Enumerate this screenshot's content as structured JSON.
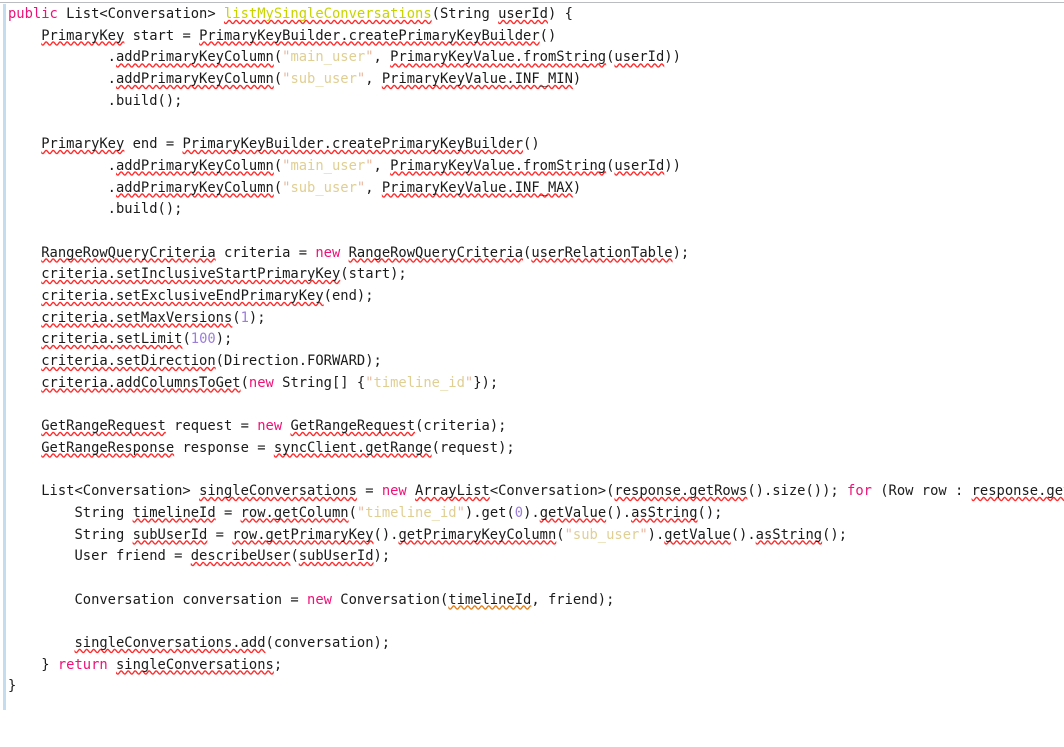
{
  "editor": {
    "language": "java",
    "top_rule_color": "#b9bcc0",
    "left_bar_color": "#c3dcee",
    "background_color": "#ffffff",
    "colors": {
      "keyword": "#ee1177",
      "method_declaration": "#c8d400",
      "string": "#e0cf93",
      "string_quote": "#e8b9a0",
      "number": "#9b7ddb",
      "plain_text": "#1a1a1a",
      "squiggle_error": "#ff2b2b",
      "squiggle_warning": "#e08020"
    }
  },
  "code": {
    "lines": [
      {
        "n": 1,
        "tokens": [
          {
            "t": "public",
            "c": "kw"
          },
          {
            "t": " List<Conversation> ",
            "c": "plain"
          },
          {
            "t": "listMySingleConversations",
            "c": "mname sq"
          },
          {
            "t": "(String ",
            "c": "plain"
          },
          {
            "t": "userId",
            "c": "sq"
          },
          {
            "t": ") {",
            "c": "plain"
          }
        ]
      },
      {
        "n": 2,
        "tokens": [
          {
            "t": "    ",
            "c": "plain"
          },
          {
            "t": "PrimaryKey",
            "c": "sq"
          },
          {
            "t": " start = ",
            "c": "plain"
          },
          {
            "t": "PrimaryKeyBuilder.createPrimaryKeyBuilder",
            "c": "sq"
          },
          {
            "t": "()",
            "c": "plain"
          }
        ]
      },
      {
        "n": 3,
        "tokens": [
          {
            "t": "            .",
            "c": "plain"
          },
          {
            "t": "addPrimaryKeyColumn",
            "c": "sq"
          },
          {
            "t": "(",
            "c": "plain"
          },
          {
            "t": "\"",
            "c": "strq"
          },
          {
            "t": "main_user",
            "c": "str"
          },
          {
            "t": "\"",
            "c": "strq"
          },
          {
            "t": ", ",
            "c": "plain"
          },
          {
            "t": "PrimaryKeyValue.fromString",
            "c": "sq"
          },
          {
            "t": "(",
            "c": "plain"
          },
          {
            "t": "userId",
            "c": "sq"
          },
          {
            "t": "))",
            "c": "plain"
          }
        ]
      },
      {
        "n": 4,
        "tokens": [
          {
            "t": "            .",
            "c": "plain"
          },
          {
            "t": "addPrimaryKeyColumn",
            "c": "sq"
          },
          {
            "t": "(",
            "c": "plain"
          },
          {
            "t": "\"",
            "c": "strq"
          },
          {
            "t": "sub_user",
            "c": "str"
          },
          {
            "t": "\"",
            "c": "strq"
          },
          {
            "t": ", ",
            "c": "plain"
          },
          {
            "t": "PrimaryKeyValue.INF_MIN",
            "c": "sq"
          },
          {
            "t": ")",
            "c": "plain"
          }
        ]
      },
      {
        "n": 5,
        "tokens": [
          {
            "t": "            .build();",
            "c": "plain"
          }
        ]
      },
      {
        "n": 6,
        "tokens": []
      },
      {
        "n": 7,
        "tokens": [
          {
            "t": "    ",
            "c": "plain"
          },
          {
            "t": "PrimaryKey",
            "c": "sq"
          },
          {
            "t": " end = ",
            "c": "plain"
          },
          {
            "t": "PrimaryKeyBuilder.createPrimaryKeyBuilder",
            "c": "sq"
          },
          {
            "t": "()",
            "c": "plain"
          }
        ]
      },
      {
        "n": 8,
        "tokens": [
          {
            "t": "            .",
            "c": "plain"
          },
          {
            "t": "addPrimaryKeyColumn",
            "c": "sq"
          },
          {
            "t": "(",
            "c": "plain"
          },
          {
            "t": "\"",
            "c": "strq"
          },
          {
            "t": "main_user",
            "c": "str"
          },
          {
            "t": "\"",
            "c": "strq"
          },
          {
            "t": ", ",
            "c": "plain"
          },
          {
            "t": "PrimaryKeyValue.fromString",
            "c": "sq"
          },
          {
            "t": "(",
            "c": "plain"
          },
          {
            "t": "userId",
            "c": "sq"
          },
          {
            "t": "))",
            "c": "plain"
          }
        ]
      },
      {
        "n": 9,
        "tokens": [
          {
            "t": "            .",
            "c": "plain"
          },
          {
            "t": "addPrimaryKeyColumn",
            "c": "sq"
          },
          {
            "t": "(",
            "c": "plain"
          },
          {
            "t": "\"",
            "c": "strq"
          },
          {
            "t": "sub_user",
            "c": "str"
          },
          {
            "t": "\"",
            "c": "strq"
          },
          {
            "t": ", ",
            "c": "plain"
          },
          {
            "t": "PrimaryKeyValue.INF_MAX",
            "c": "sq"
          },
          {
            "t": ")",
            "c": "plain"
          }
        ]
      },
      {
        "n": 10,
        "tokens": [
          {
            "t": "            .build();",
            "c": "plain"
          }
        ]
      },
      {
        "n": 11,
        "tokens": []
      },
      {
        "n": 12,
        "tokens": [
          {
            "t": "    ",
            "c": "plain"
          },
          {
            "t": "RangeRowQueryCriteria",
            "c": "sq"
          },
          {
            "t": " criteria = ",
            "c": "plain"
          },
          {
            "t": "new",
            "c": "kw"
          },
          {
            "t": " ",
            "c": "plain"
          },
          {
            "t": "RangeRowQueryCriteria",
            "c": "sq"
          },
          {
            "t": "(",
            "c": "plain"
          },
          {
            "t": "userRelationTable",
            "c": "sq"
          },
          {
            "t": ");",
            "c": "plain"
          }
        ]
      },
      {
        "n": 13,
        "tokens": [
          {
            "t": "    ",
            "c": "plain"
          },
          {
            "t": "criteria.setInclusiveStartPrimaryKey",
            "c": "sq"
          },
          {
            "t": "(start);",
            "c": "plain"
          }
        ]
      },
      {
        "n": 14,
        "tokens": [
          {
            "t": "    ",
            "c": "plain"
          },
          {
            "t": "criteria.setExclusiveEndPrimaryKey",
            "c": "sq"
          },
          {
            "t": "(end);",
            "c": "plain"
          }
        ]
      },
      {
        "n": 15,
        "tokens": [
          {
            "t": "    ",
            "c": "plain"
          },
          {
            "t": "criteria.setMaxVersions",
            "c": "sq"
          },
          {
            "t": "(",
            "c": "plain"
          },
          {
            "t": "1",
            "c": "num"
          },
          {
            "t": ");",
            "c": "plain"
          }
        ]
      },
      {
        "n": 16,
        "tokens": [
          {
            "t": "    ",
            "c": "plain"
          },
          {
            "t": "criteria.setLimit",
            "c": "sq"
          },
          {
            "t": "(",
            "c": "plain"
          },
          {
            "t": "100",
            "c": "num"
          },
          {
            "t": ");",
            "c": "plain"
          }
        ]
      },
      {
        "n": 17,
        "tokens": [
          {
            "t": "    ",
            "c": "plain"
          },
          {
            "t": "criteria.setDirection",
            "c": "sq"
          },
          {
            "t": "(Direction.FORWARD);",
            "c": "plain"
          }
        ]
      },
      {
        "n": 18,
        "tokens": [
          {
            "t": "    ",
            "c": "plain"
          },
          {
            "t": "criteria.addColumnsToGet",
            "c": "sq"
          },
          {
            "t": "(",
            "c": "plain"
          },
          {
            "t": "new",
            "c": "kw"
          },
          {
            "t": " String[] {",
            "c": "plain"
          },
          {
            "t": "\"",
            "c": "strq"
          },
          {
            "t": "timeline_id",
            "c": "str"
          },
          {
            "t": "\"",
            "c": "strq"
          },
          {
            "t": "});",
            "c": "plain"
          }
        ]
      },
      {
        "n": 19,
        "tokens": []
      },
      {
        "n": 20,
        "tokens": [
          {
            "t": "    ",
            "c": "plain"
          },
          {
            "t": "GetRangeRequest",
            "c": "sq"
          },
          {
            "t": " request = ",
            "c": "plain"
          },
          {
            "t": "new",
            "c": "kw"
          },
          {
            "t": " ",
            "c": "plain"
          },
          {
            "t": "GetRangeRequest",
            "c": "sq"
          },
          {
            "t": "(criteria);",
            "c": "plain"
          }
        ]
      },
      {
        "n": 21,
        "tokens": [
          {
            "t": "    ",
            "c": "plain"
          },
          {
            "t": "GetRangeResponse",
            "c": "sq"
          },
          {
            "t": " response = ",
            "c": "plain"
          },
          {
            "t": "syncClient.getRange",
            "c": "sq"
          },
          {
            "t": "(request);",
            "c": "plain"
          }
        ]
      },
      {
        "n": 22,
        "tokens": []
      },
      {
        "n": 23,
        "tokens": [
          {
            "t": "    List<Conversation> ",
            "c": "plain"
          },
          {
            "t": "singleConversations",
            "c": "sq"
          },
          {
            "t": " = ",
            "c": "plain"
          },
          {
            "t": "new",
            "c": "kw"
          },
          {
            "t": " ",
            "c": "plain"
          },
          {
            "t": "ArrayList",
            "c": "sq"
          },
          {
            "t": "<Conversation>(",
            "c": "plain"
          },
          {
            "t": "response.getRows",
            "c": "sq"
          },
          {
            "t": "().size()); ",
            "c": "plain"
          },
          {
            "t": "for",
            "c": "kw"
          },
          {
            "t": " (Row row : ",
            "c": "plain"
          },
          {
            "t": "response.getRows",
            "c": "sq"
          },
          {
            "t": "()) {",
            "c": "plain"
          }
        ]
      },
      {
        "n": 24,
        "tokens": [
          {
            "t": "        String ",
            "c": "plain"
          },
          {
            "t": "timelineId",
            "c": "sq"
          },
          {
            "t": " = ",
            "c": "plain"
          },
          {
            "t": "row.getColumn",
            "c": "sq"
          },
          {
            "t": "(",
            "c": "plain"
          },
          {
            "t": "\"",
            "c": "strq"
          },
          {
            "t": "timeline_id",
            "c": "str"
          },
          {
            "t": "\"",
            "c": "strq"
          },
          {
            "t": ").get(",
            "c": "plain"
          },
          {
            "t": "0",
            "c": "num"
          },
          {
            "t": ").",
            "c": "plain"
          },
          {
            "t": "getValue",
            "c": "sq"
          },
          {
            "t": "().",
            "c": "plain"
          },
          {
            "t": "asString",
            "c": "sq"
          },
          {
            "t": "();",
            "c": "plain"
          }
        ]
      },
      {
        "n": 25,
        "tokens": [
          {
            "t": "        String ",
            "c": "plain"
          },
          {
            "t": "subUserId",
            "c": "sq"
          },
          {
            "t": " = ",
            "c": "plain"
          },
          {
            "t": "row.getPrimaryKey",
            "c": "sq"
          },
          {
            "t": "().",
            "c": "plain"
          },
          {
            "t": "getPrimaryKeyColumn",
            "c": "sq"
          },
          {
            "t": "(",
            "c": "plain"
          },
          {
            "t": "\"",
            "c": "strq"
          },
          {
            "t": "sub_user",
            "c": "str"
          },
          {
            "t": "\"",
            "c": "strq"
          },
          {
            "t": ").",
            "c": "plain"
          },
          {
            "t": "getValue",
            "c": "sq"
          },
          {
            "t": "().",
            "c": "plain"
          },
          {
            "t": "asString",
            "c": "sq"
          },
          {
            "t": "();",
            "c": "plain"
          }
        ]
      },
      {
        "n": 26,
        "tokens": [
          {
            "t": "        User friend = ",
            "c": "plain"
          },
          {
            "t": "describeUser",
            "c": "sq"
          },
          {
            "t": "(",
            "c": "plain"
          },
          {
            "t": "subUserId",
            "c": "sq"
          },
          {
            "t": ");",
            "c": "plain"
          }
        ]
      },
      {
        "n": 27,
        "tokens": []
      },
      {
        "n": 28,
        "tokens": [
          {
            "t": "        Conversation conversation = ",
            "c": "plain"
          },
          {
            "t": "new",
            "c": "kw"
          },
          {
            "t": " Conversation(",
            "c": "plain"
          },
          {
            "t": "timelineId",
            "c": "sq-o"
          },
          {
            "t": ", friend);",
            "c": "plain"
          }
        ]
      },
      {
        "n": 29,
        "tokens": []
      },
      {
        "n": 30,
        "tokens": [
          {
            "t": "        ",
            "c": "plain"
          },
          {
            "t": "singleConversations.add",
            "c": "sq"
          },
          {
            "t": "(conversation);",
            "c": "plain"
          }
        ]
      },
      {
        "n": 31,
        "tokens": [
          {
            "t": "    } ",
            "c": "plain"
          },
          {
            "t": "return",
            "c": "kw"
          },
          {
            "t": " ",
            "c": "plain"
          },
          {
            "t": "singleConversations",
            "c": "sq"
          },
          {
            "t": ";",
            "c": "plain"
          }
        ]
      },
      {
        "n": 32,
        "tokens": [
          {
            "t": "}",
            "c": "plain"
          }
        ]
      }
    ]
  }
}
